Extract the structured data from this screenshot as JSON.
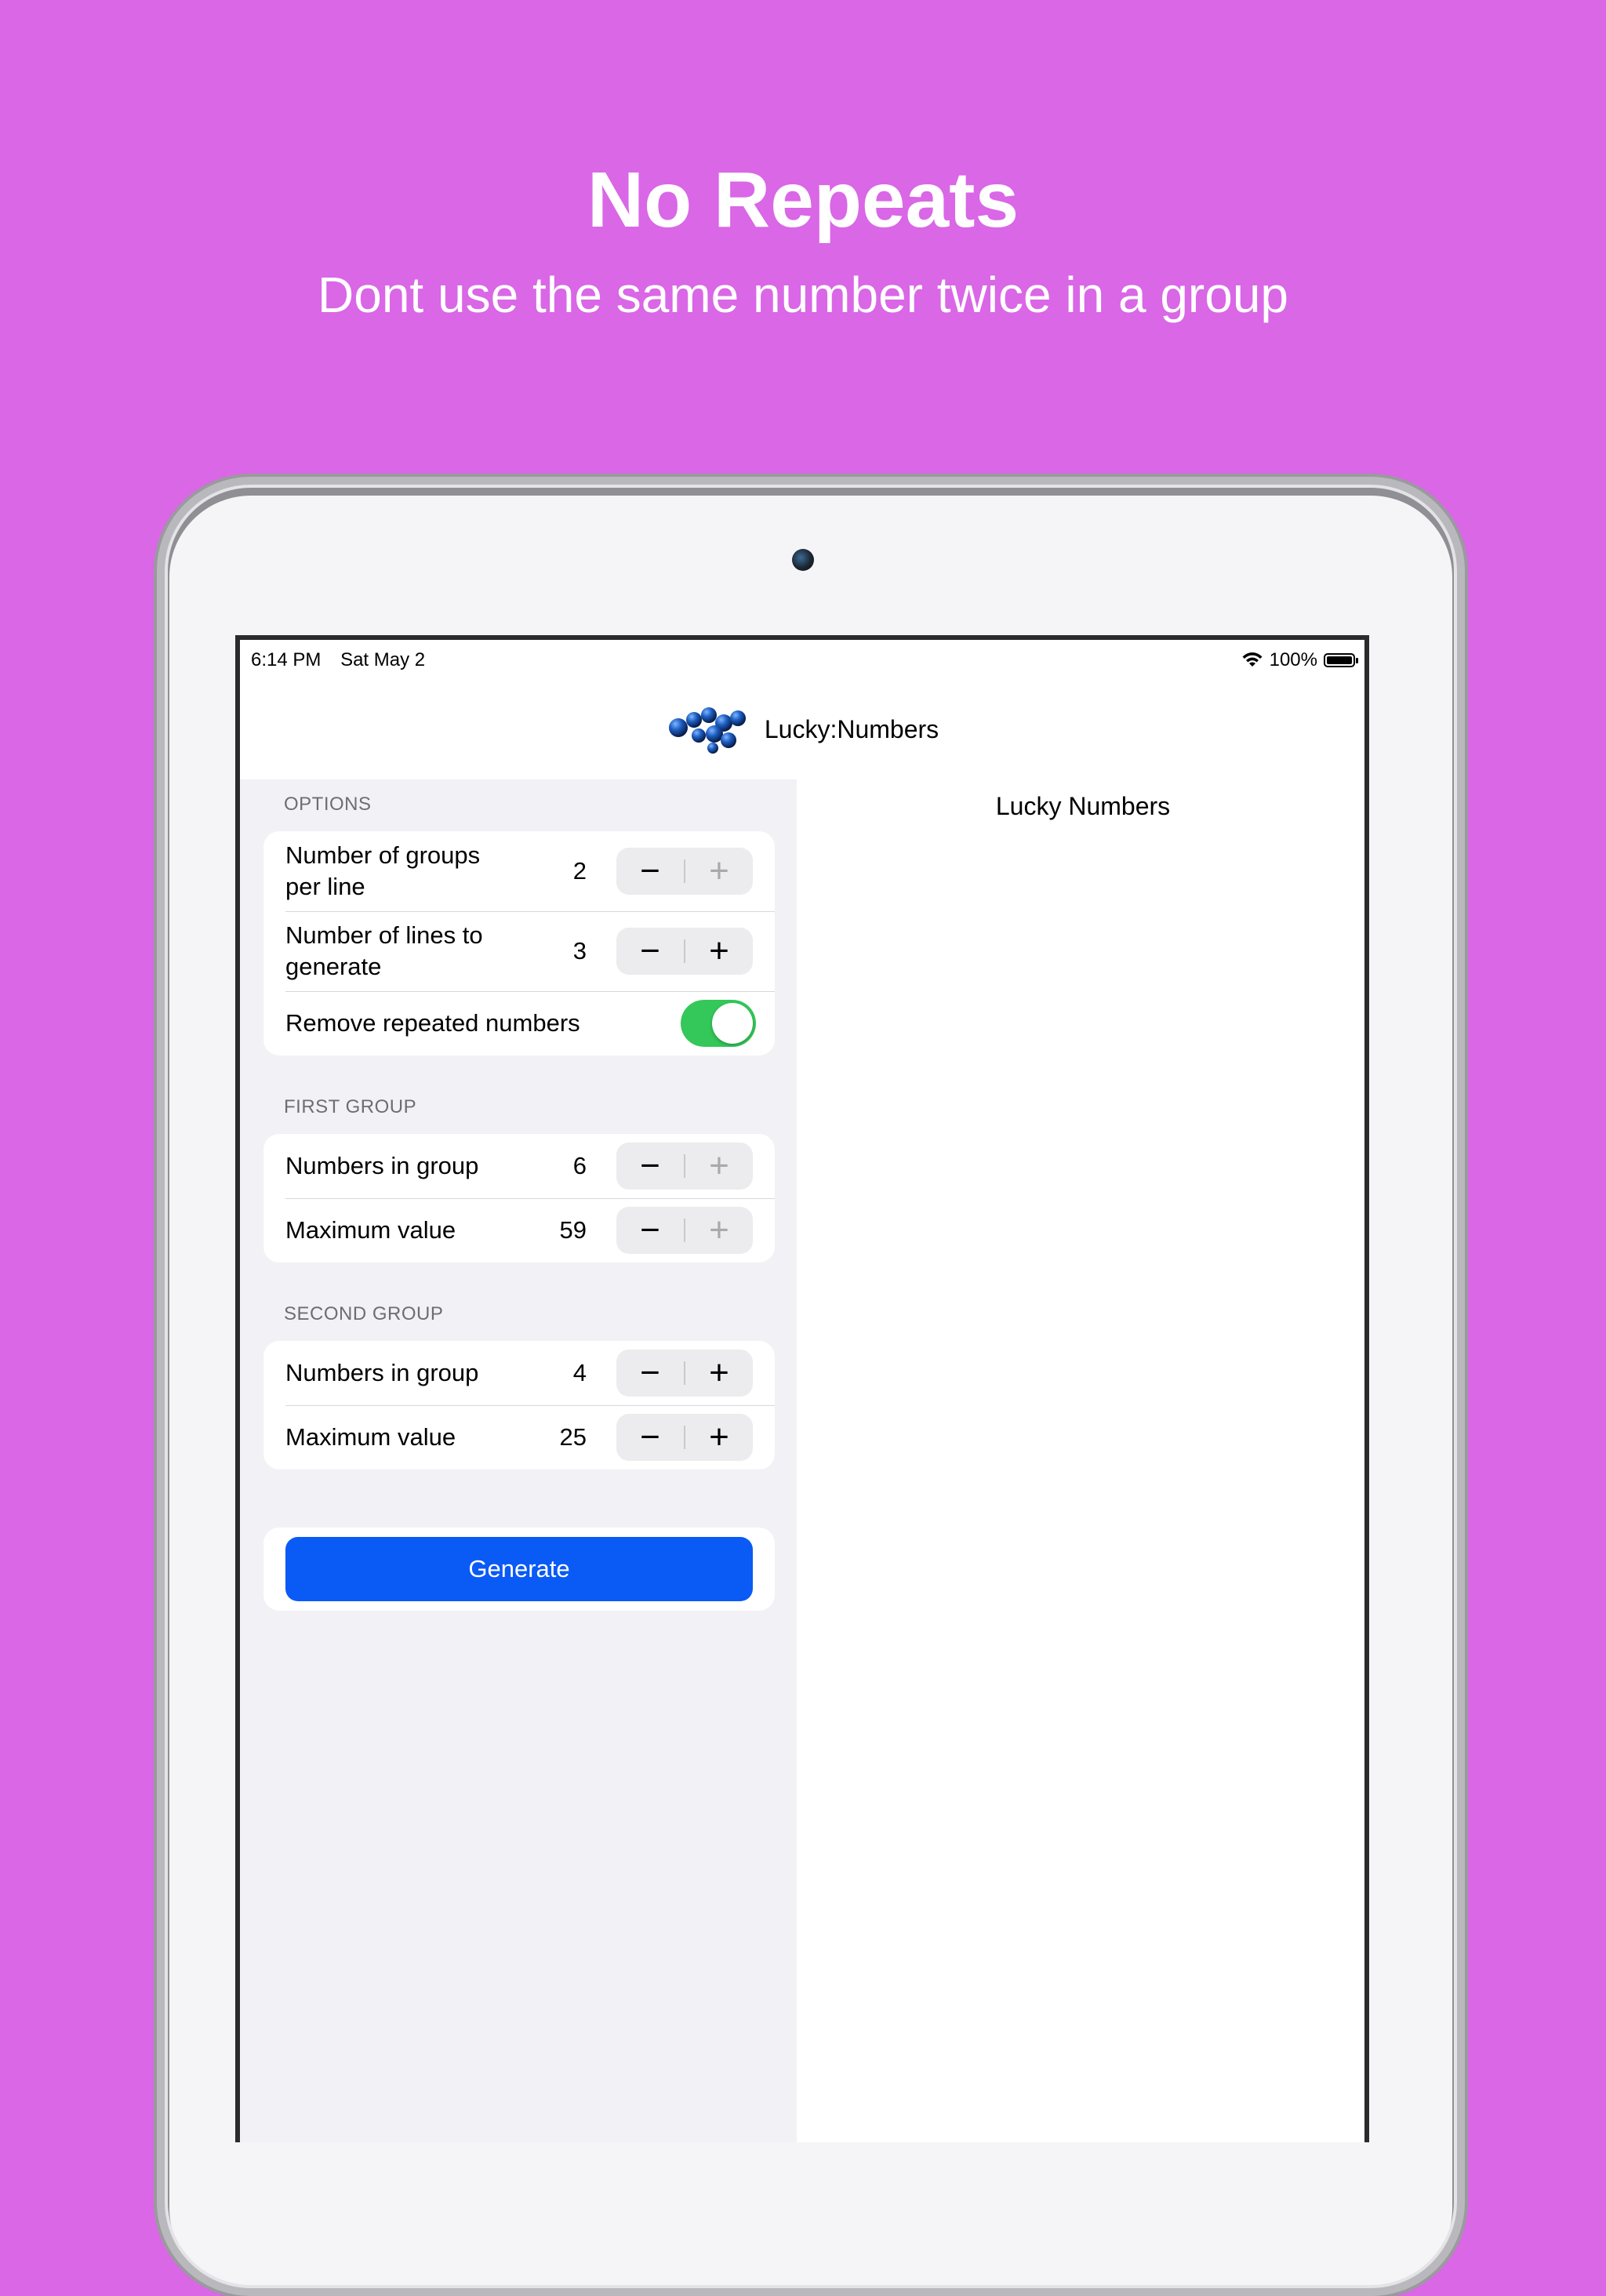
{
  "promo": {
    "headline": "No Repeats",
    "subline": "Dont use the same number twice in a group"
  },
  "status_bar": {
    "time": "6:14 PM",
    "date": "Sat May 2",
    "battery": "100%"
  },
  "nav": {
    "title": "Lucky:Numbers",
    "logo_icon": "lottery-balls-icon"
  },
  "results": {
    "title": "Lucky Numbers"
  },
  "options": {
    "header": "OPTIONS",
    "groups_per_line": {
      "label": "Number of groups per line",
      "value": "2",
      "minus": "−",
      "plus": "+"
    },
    "lines_to_generate": {
      "label": "Number of lines to generate",
      "value": "3",
      "minus": "−",
      "plus": "+"
    },
    "remove_repeats": {
      "label": "Remove repeated numbers",
      "on": true
    }
  },
  "first_group": {
    "header": "FIRST GROUP",
    "numbers_in_group": {
      "label": "Numbers in group",
      "value": "6",
      "minus": "−",
      "plus": "+"
    },
    "maximum_value": {
      "label": "Maximum value",
      "value": "59",
      "minus": "−",
      "plus": "+"
    }
  },
  "second_group": {
    "header": "SECOND GROUP",
    "numbers_in_group": {
      "label": "Numbers in group",
      "value": "4",
      "minus": "−",
      "plus": "+"
    },
    "maximum_value": {
      "label": "Maximum value",
      "value": "25",
      "minus": "−",
      "plus": "+"
    }
  },
  "generate": {
    "label": "Generate"
  },
  "colors": {
    "background": "#d967e6",
    "accent": "#0a5af5",
    "toggle_on": "#34c759"
  }
}
